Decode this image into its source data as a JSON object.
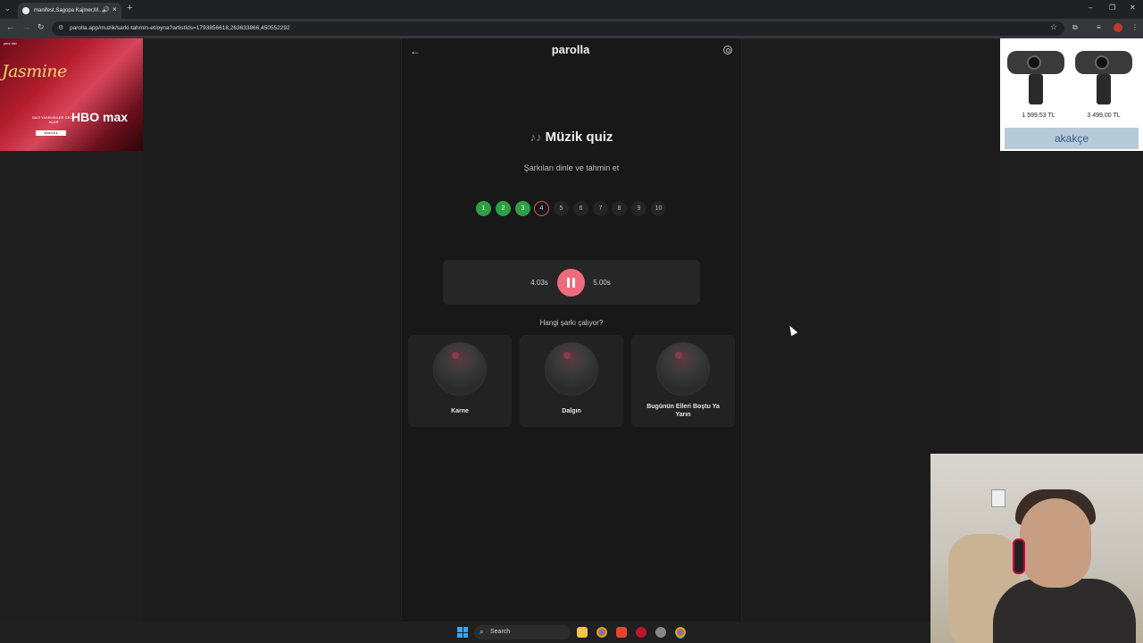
{
  "browser": {
    "tab_title": "manifest,Sagopa Kajmer,M...",
    "url": "parolla.app/muzik/sarki-tahmin-et/oyna?artistIds=1793856618,263633866,450552292"
  },
  "app": {
    "brand": "parolla",
    "quiz_title": "Müzik quiz",
    "quiz_subtitle": "Şarkıları dinle ve tahmin et",
    "steps": [
      {
        "label": "1",
        "state": "correct"
      },
      {
        "label": "2",
        "state": "correct"
      },
      {
        "label": "3",
        "state": "correct"
      },
      {
        "label": "4",
        "state": "current"
      },
      {
        "label": "5",
        "state": "pending"
      },
      {
        "label": "6",
        "state": "pending"
      },
      {
        "label": "7",
        "state": "pending"
      },
      {
        "label": "8",
        "state": "pending"
      },
      {
        "label": "9",
        "state": "pending"
      },
      {
        "label": "10",
        "state": "pending"
      }
    ],
    "player": {
      "current_time": "4.03s",
      "total_time": "5.00s"
    },
    "question": "Hangi şarkı çalıyor?",
    "options": [
      "Karne",
      "Dalgın",
      "Bugünün Elleri Boştu Ya Yarın"
    ]
  },
  "ad_left": {
    "tag": "yeni dizi",
    "title": "Jasmine",
    "subtitle": "BAZI YASEMİNLER GECE AÇAR",
    "brand": "HBO max",
    "button": "ŞİMDİ İZLE"
  },
  "ad_right": {
    "prices": [
      "1 599,53 TL",
      "3 499,00 TL"
    ],
    "brand": "akakçe"
  },
  "taskbar": {
    "search_label": "Search"
  },
  "colors": {
    "correct": "#2ea043",
    "current_border": "#d9534f",
    "accent": "#ee6b7d"
  }
}
